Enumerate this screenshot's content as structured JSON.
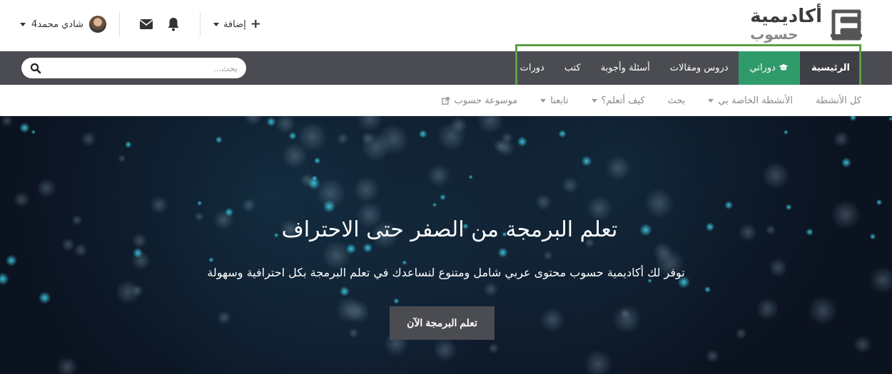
{
  "logo": {
    "line1": "أكاديمية",
    "line2": "حسوب"
  },
  "user": {
    "name": "شادي محمد4"
  },
  "add_label": "إضافة",
  "nav": {
    "items": [
      {
        "label": "الرئيسية"
      },
      {
        "label": "دوراتي"
      },
      {
        "label": "دروس ومقالات"
      },
      {
        "label": "أسئلة وأجوبة"
      },
      {
        "label": "كتب"
      },
      {
        "label": "دورات"
      }
    ]
  },
  "search": {
    "placeholder": "بحث..."
  },
  "subnav": {
    "items": [
      {
        "label": "كل الأنشطة"
      },
      {
        "label": "الأنشطة الخاصة بي"
      },
      {
        "label": "بحث"
      },
      {
        "label": "كيف أتعلم؟"
      },
      {
        "label": "تابعنا"
      },
      {
        "label": "موسوعة حسوب"
      }
    ]
  },
  "hero": {
    "title": "تعلم البرمجة من الصفر حتى الاحتراف",
    "subtitle": "توفر لك أكاديمية حسوب محتوى عربي شامل ومتنوع لنساعدك في تعلم البرمجة بكل احترافية وسهولة",
    "button": "تعلم البرمجة الآن"
  },
  "colors": {
    "navbar": "#4a4c52",
    "active_green": "#2f9b6a",
    "highlight_border": "#5aa043",
    "hero_bg": "#0b1220"
  }
}
